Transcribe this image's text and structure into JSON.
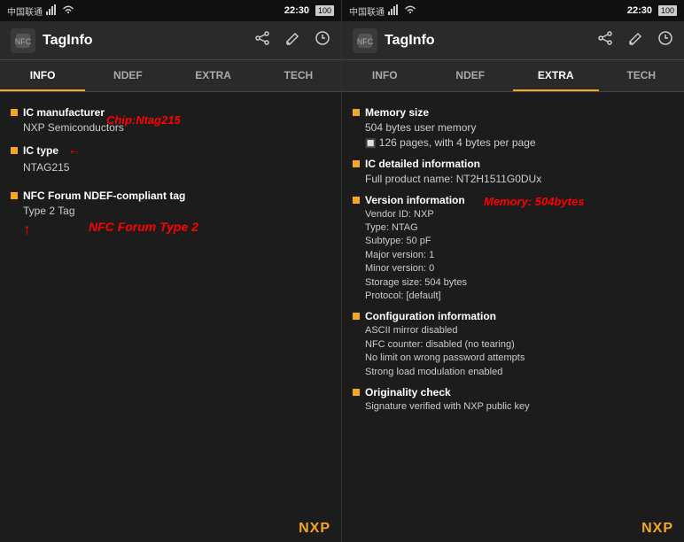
{
  "left_screen": {
    "status_bar": {
      "carrier": "中国联通",
      "time": "22:30",
      "icons": [
        "signal",
        "wifi",
        "battery"
      ]
    },
    "title": "TagInfo",
    "tabs": [
      "INFO",
      "NDEF",
      "EXTRA",
      "TECH"
    ],
    "active_tab": "INFO",
    "sections": [
      {
        "id": "ic-manufacturer",
        "title": "IC manufacturer",
        "value": "NXP Semiconductors"
      },
      {
        "id": "ic-type",
        "title": "IC type",
        "value": "NTAG215"
      },
      {
        "id": "nfc-forum",
        "title": "NFC Forum NDEF-compliant tag",
        "value": "Type 2 Tag"
      }
    ],
    "annotation_chip": "Chip:Ntag215",
    "annotation_nfc": "NFC Forum Type 2",
    "nxp_logo": "NXP"
  },
  "right_screen": {
    "status_bar": {
      "carrier": "中国联通",
      "time": "22:30"
    },
    "title": "TagInfo",
    "tabs": [
      "INFO",
      "NDEF",
      "EXTRA",
      "TECH"
    ],
    "active_tab": "EXTRA",
    "sections": [
      {
        "id": "memory-size",
        "title": "Memory size",
        "value": "504 bytes user memory\n126 pages, with 4 bytes per page"
      },
      {
        "id": "ic-detailed",
        "title": "IC detailed information",
        "value": "Full product name: NT2H1511G0DUx"
      },
      {
        "id": "version-info",
        "title": "Version information",
        "value": "Vendor ID: NXP\nType: NTAG\nSubtype: 50 pF\nMajor version: 1\nMinor version: 0\nStorage size: 504 bytes\nProtocol: [default]"
      },
      {
        "id": "config-info",
        "title": "Configuration information",
        "value": "ASCII mirror disabled\nNFC counter: disabled (no tearing)\nNo limit on wrong password attempts\nStrong load modulation enabled"
      },
      {
        "id": "originality",
        "title": "Originality check",
        "value": "Signature verified with NXP public key"
      }
    ],
    "annotation_memory": "Memory: 504bytes",
    "nxp_logo": "NXP"
  },
  "actions": {
    "share": "share",
    "edit": "edit",
    "history": "history"
  }
}
